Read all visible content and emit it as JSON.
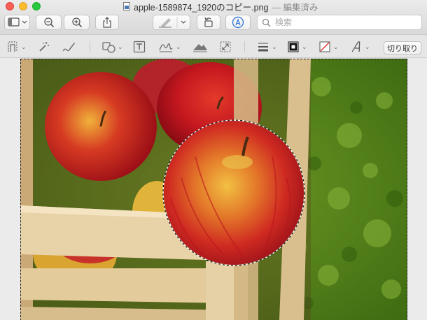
{
  "window": {
    "filename": "apple-1589874_1920のコピー.png",
    "status": "— 編集済み"
  },
  "toolbar": {
    "buttons": [
      "sidebar-toggle",
      "zoom-out",
      "zoom-in",
      "share",
      "highlight-pen",
      "rotate-left",
      "markup"
    ],
    "search_placeholder": "検索"
  },
  "markup": {
    "tools": [
      "selection-tool",
      "instant-alpha",
      "sketch",
      "shapes",
      "text",
      "sign",
      "adjust-color",
      "adjust-size",
      "shape-style",
      "border-color",
      "fill-color",
      "text-style"
    ],
    "crop_label": "切り取り"
  },
  "colors": {
    "accent": "#3b7bd8",
    "apple_red": "#c3171f",
    "apple_yellow": "#e8b22a",
    "grass": "#5b8a1c",
    "crate": "#e8d2a8"
  }
}
